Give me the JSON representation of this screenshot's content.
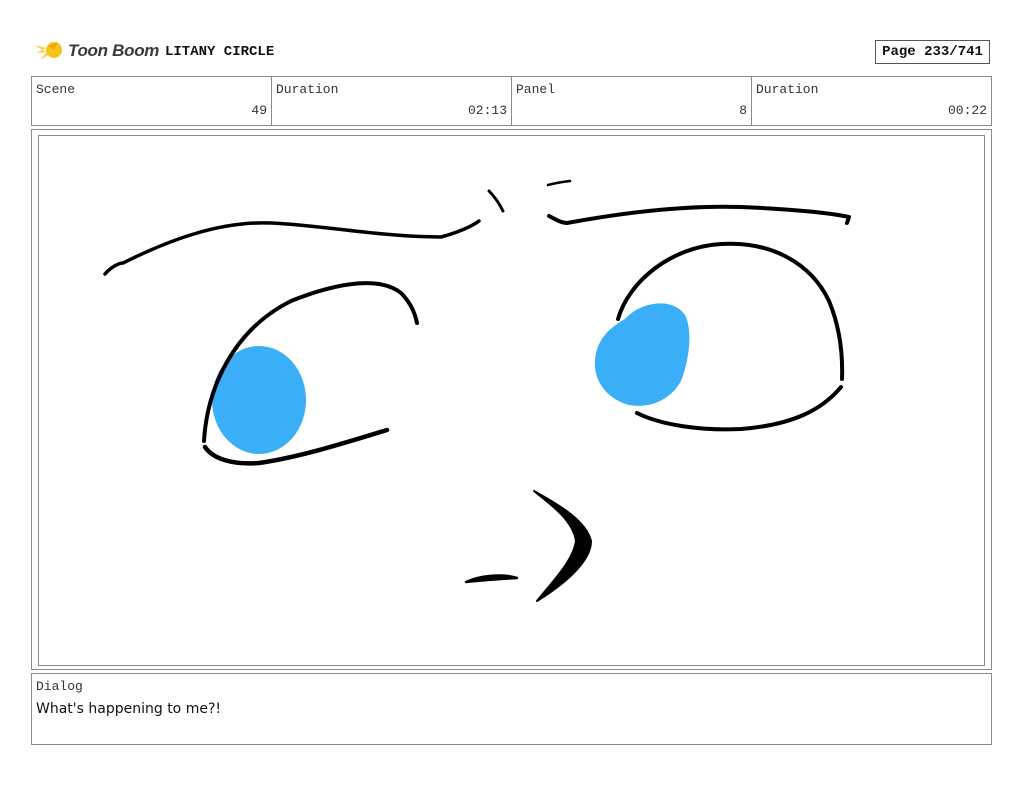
{
  "header": {
    "logo_text": "Toon Boom",
    "project_title": "LITANY CIRCLE",
    "page_label": "Page 233/741"
  },
  "info": {
    "scene_label": "Scene",
    "scene_value": "49",
    "scene_duration_label": "Duration",
    "scene_duration_value": "02:13",
    "panel_label": "Panel",
    "panel_value": "8",
    "panel_duration_label": "Duration",
    "panel_duration_value": "00:22"
  },
  "dialog": {
    "label": "Dialog",
    "text": "What's happening to me?!"
  },
  "colors": {
    "iris": "#3aaef6",
    "line": "#000000",
    "logo_star": "#f5c518",
    "border": "#8a8a8a"
  }
}
